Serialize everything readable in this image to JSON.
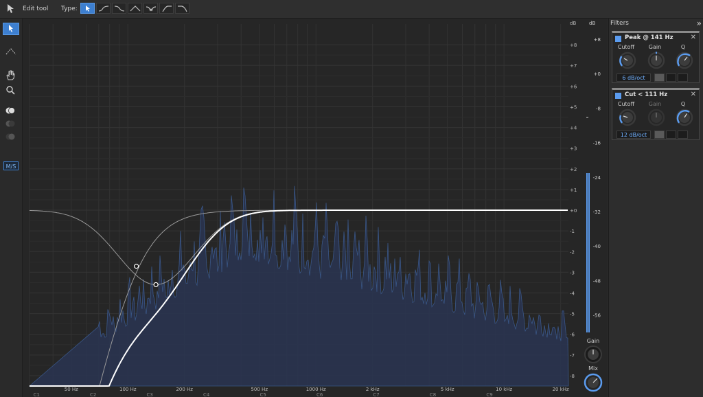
{
  "topbar": {
    "edit_tool_label": "Edit tool",
    "type_label": "Type:",
    "type_buttons": [
      "edit-pointer",
      "low-shelf",
      "high-shelf",
      "peak",
      "notch",
      "low-cut",
      "high-cut"
    ]
  },
  "leftbar": {
    "ms_label": "M/S"
  },
  "graph": {
    "db_unit": "dB",
    "right_db_unit": "dB",
    "gain_label": "Gain",
    "mix_label": "Mix",
    "db_ticks": [
      "+8",
      "+7",
      "+6",
      "+5",
      "+4",
      "+3",
      "+2",
      "+1",
      "+0",
      "-1",
      "-2",
      "-3",
      "-4",
      "-5",
      "-6",
      "-7",
      "-8"
    ],
    "meter_ticks": [
      "+8",
      "+0",
      "-8",
      "-16",
      "-24",
      "-32",
      "-40",
      "-48",
      "-56"
    ],
    "freq_labels": [
      "50 Hz",
      "100 Hz",
      "200 Hz",
      "500 Hz",
      "1000 Hz",
      "2 kHz",
      "5 kHz",
      "10 kHz",
      "20 kHz"
    ],
    "note_labels": [
      "C1",
      "C2",
      "C3",
      "C4",
      "C5",
      "C6",
      "C7",
      "C8",
      "C9"
    ],
    "colors": {
      "spectrum": "#3d5f98",
      "curve": "#ffffff",
      "accent": "#5b9cf0"
    }
  },
  "filters_panel": {
    "title": "Filters",
    "collapse_icon": "»",
    "cards": [
      {
        "name": "Peak @ 141 Hz",
        "cutoff_label": "Cutoff",
        "gain_label": "Gain",
        "q_label": "Q",
        "slope": "6  dB/oct",
        "gain_enabled": true
      },
      {
        "name": "Cut < 111 Hz",
        "cutoff_label": "Cutoff",
        "gain_label": "Gain",
        "q_label": "Q",
        "slope": "12  dB/oct",
        "gain_enabled": false
      }
    ]
  }
}
